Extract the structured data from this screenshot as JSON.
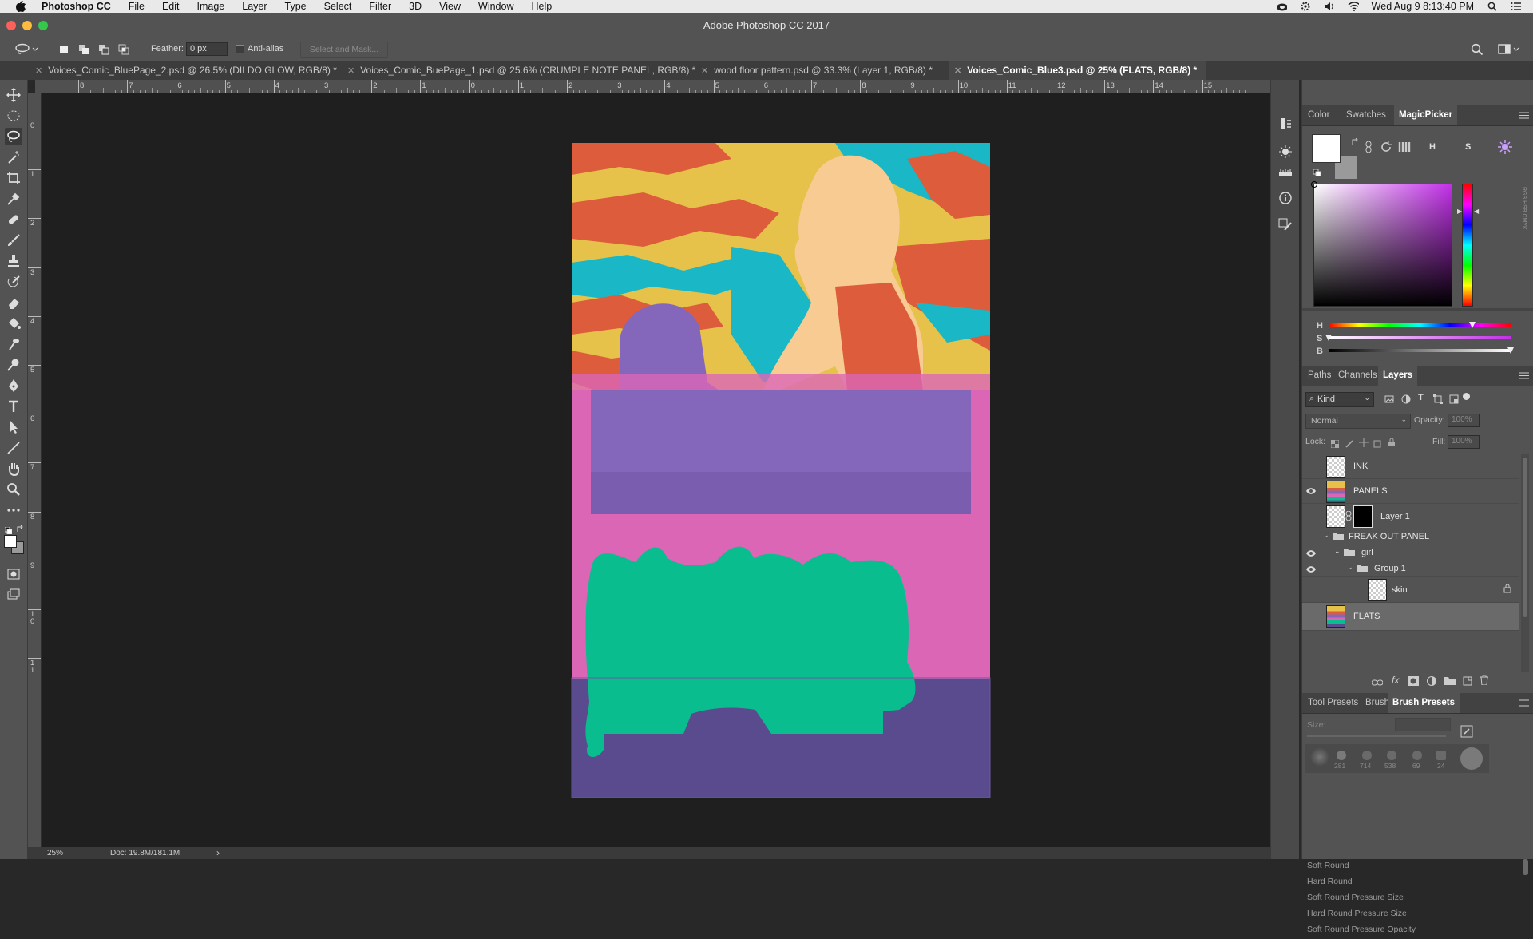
{
  "menubar": {
    "app_name": "Photoshop CC",
    "items": [
      "File",
      "Edit",
      "Image",
      "Layer",
      "Type",
      "Select",
      "Filter",
      "3D",
      "View",
      "Window",
      "Help"
    ],
    "clock": "Wed Aug 9  8:13:40 PM"
  },
  "window": {
    "title": "Adobe Photoshop CC 2017"
  },
  "options": {
    "feather_label": "Feather:",
    "feather_value": "0 px",
    "antialias_label": "Anti-alias",
    "select_mask_label": "Select and Mask..."
  },
  "tabs": [
    {
      "label": "Voices_Comic_BluePage_2.psd @ 26.5% (DILDO GLOW, RGB/8) *"
    },
    {
      "label": "Voices_Comic_BuePage_1.psd @ 25.6% (CRUMPLE NOTE PANEL, RGB/8) *"
    },
    {
      "label": "wood floor pattern.psd @ 33.3% (Layer 1, RGB/8) *"
    },
    {
      "label": "Voices_Comic_Blue3.psd @ 25% (FLATS, RGB/8) *"
    }
  ],
  "ruler": {
    "h": [
      "8",
      "7",
      "6",
      "5",
      "4",
      "3",
      "2",
      "1",
      "0",
      "1",
      "2",
      "3",
      "4",
      "5",
      "6",
      "7",
      "8",
      "9",
      "10",
      "11",
      "12",
      "13",
      "14",
      "15"
    ],
    "v": [
      "0",
      "1",
      "2",
      "3",
      "4",
      "5",
      "6",
      "7",
      "8",
      "9",
      "1\n0",
      "1\n1"
    ]
  },
  "color_panel": {
    "tabs": [
      "Color",
      "Swatches",
      "MagicPicker"
    ],
    "mode_h": "H",
    "mode_s": "S",
    "slider_labels": [
      "H",
      "S",
      "B"
    ],
    "h_value_fraction": 0.79,
    "s_value_fraction": 0.0,
    "b_value_fraction": 1.0,
    "foreground_color": "#ffffff",
    "background_color": "#9a9a9a"
  },
  "layers_panel": {
    "tabs": [
      "Paths",
      "Channels",
      "Layers"
    ],
    "filter_kind": "Kind",
    "blend_mode": "Normal",
    "opacity_label": "Opacity:",
    "opacity_value": "100%",
    "lock_label": "Lock:",
    "fill_label": "Fill:",
    "fill_value": "100%",
    "layers": [
      {
        "name": "INK",
        "visible": false
      },
      {
        "name": "PANELS",
        "visible": true
      },
      {
        "name": "Layer 1",
        "visible": false
      },
      {
        "name": "FREAK OUT PANEL",
        "visible": false,
        "type": "group"
      },
      {
        "name": "girl",
        "visible": true,
        "type": "group"
      },
      {
        "name": "Group 1",
        "visible": true,
        "type": "group"
      },
      {
        "name": "skin",
        "visible": false,
        "locked": true
      },
      {
        "name": "FLATS",
        "visible": false,
        "selected": true
      }
    ]
  },
  "brush_panel": {
    "tabs": [
      "Tool Presets",
      "Brush",
      "Brush Presets"
    ],
    "size_label": "Size:",
    "preset_sizes": [
      "281",
      "714",
      "538",
      "69",
      "24"
    ],
    "presets": [
      "Soft Round",
      "Hard Round",
      "Soft Round Pressure Size",
      "Hard Round Pressure Size",
      "Soft Round Pressure Opacity"
    ]
  },
  "status": {
    "zoom": "25%",
    "doc": "Doc: 19.8M/181.1M"
  },
  "colors": {
    "yellow": "#e6c24a",
    "orange_red": "#dd5c3c",
    "cyan": "#1ab7c6",
    "skin": "#f8cb92",
    "purple": "#8467bb",
    "pink": "#dc66b6",
    "green": "#0abd8e",
    "dark_purple": "#5a4a8e"
  }
}
